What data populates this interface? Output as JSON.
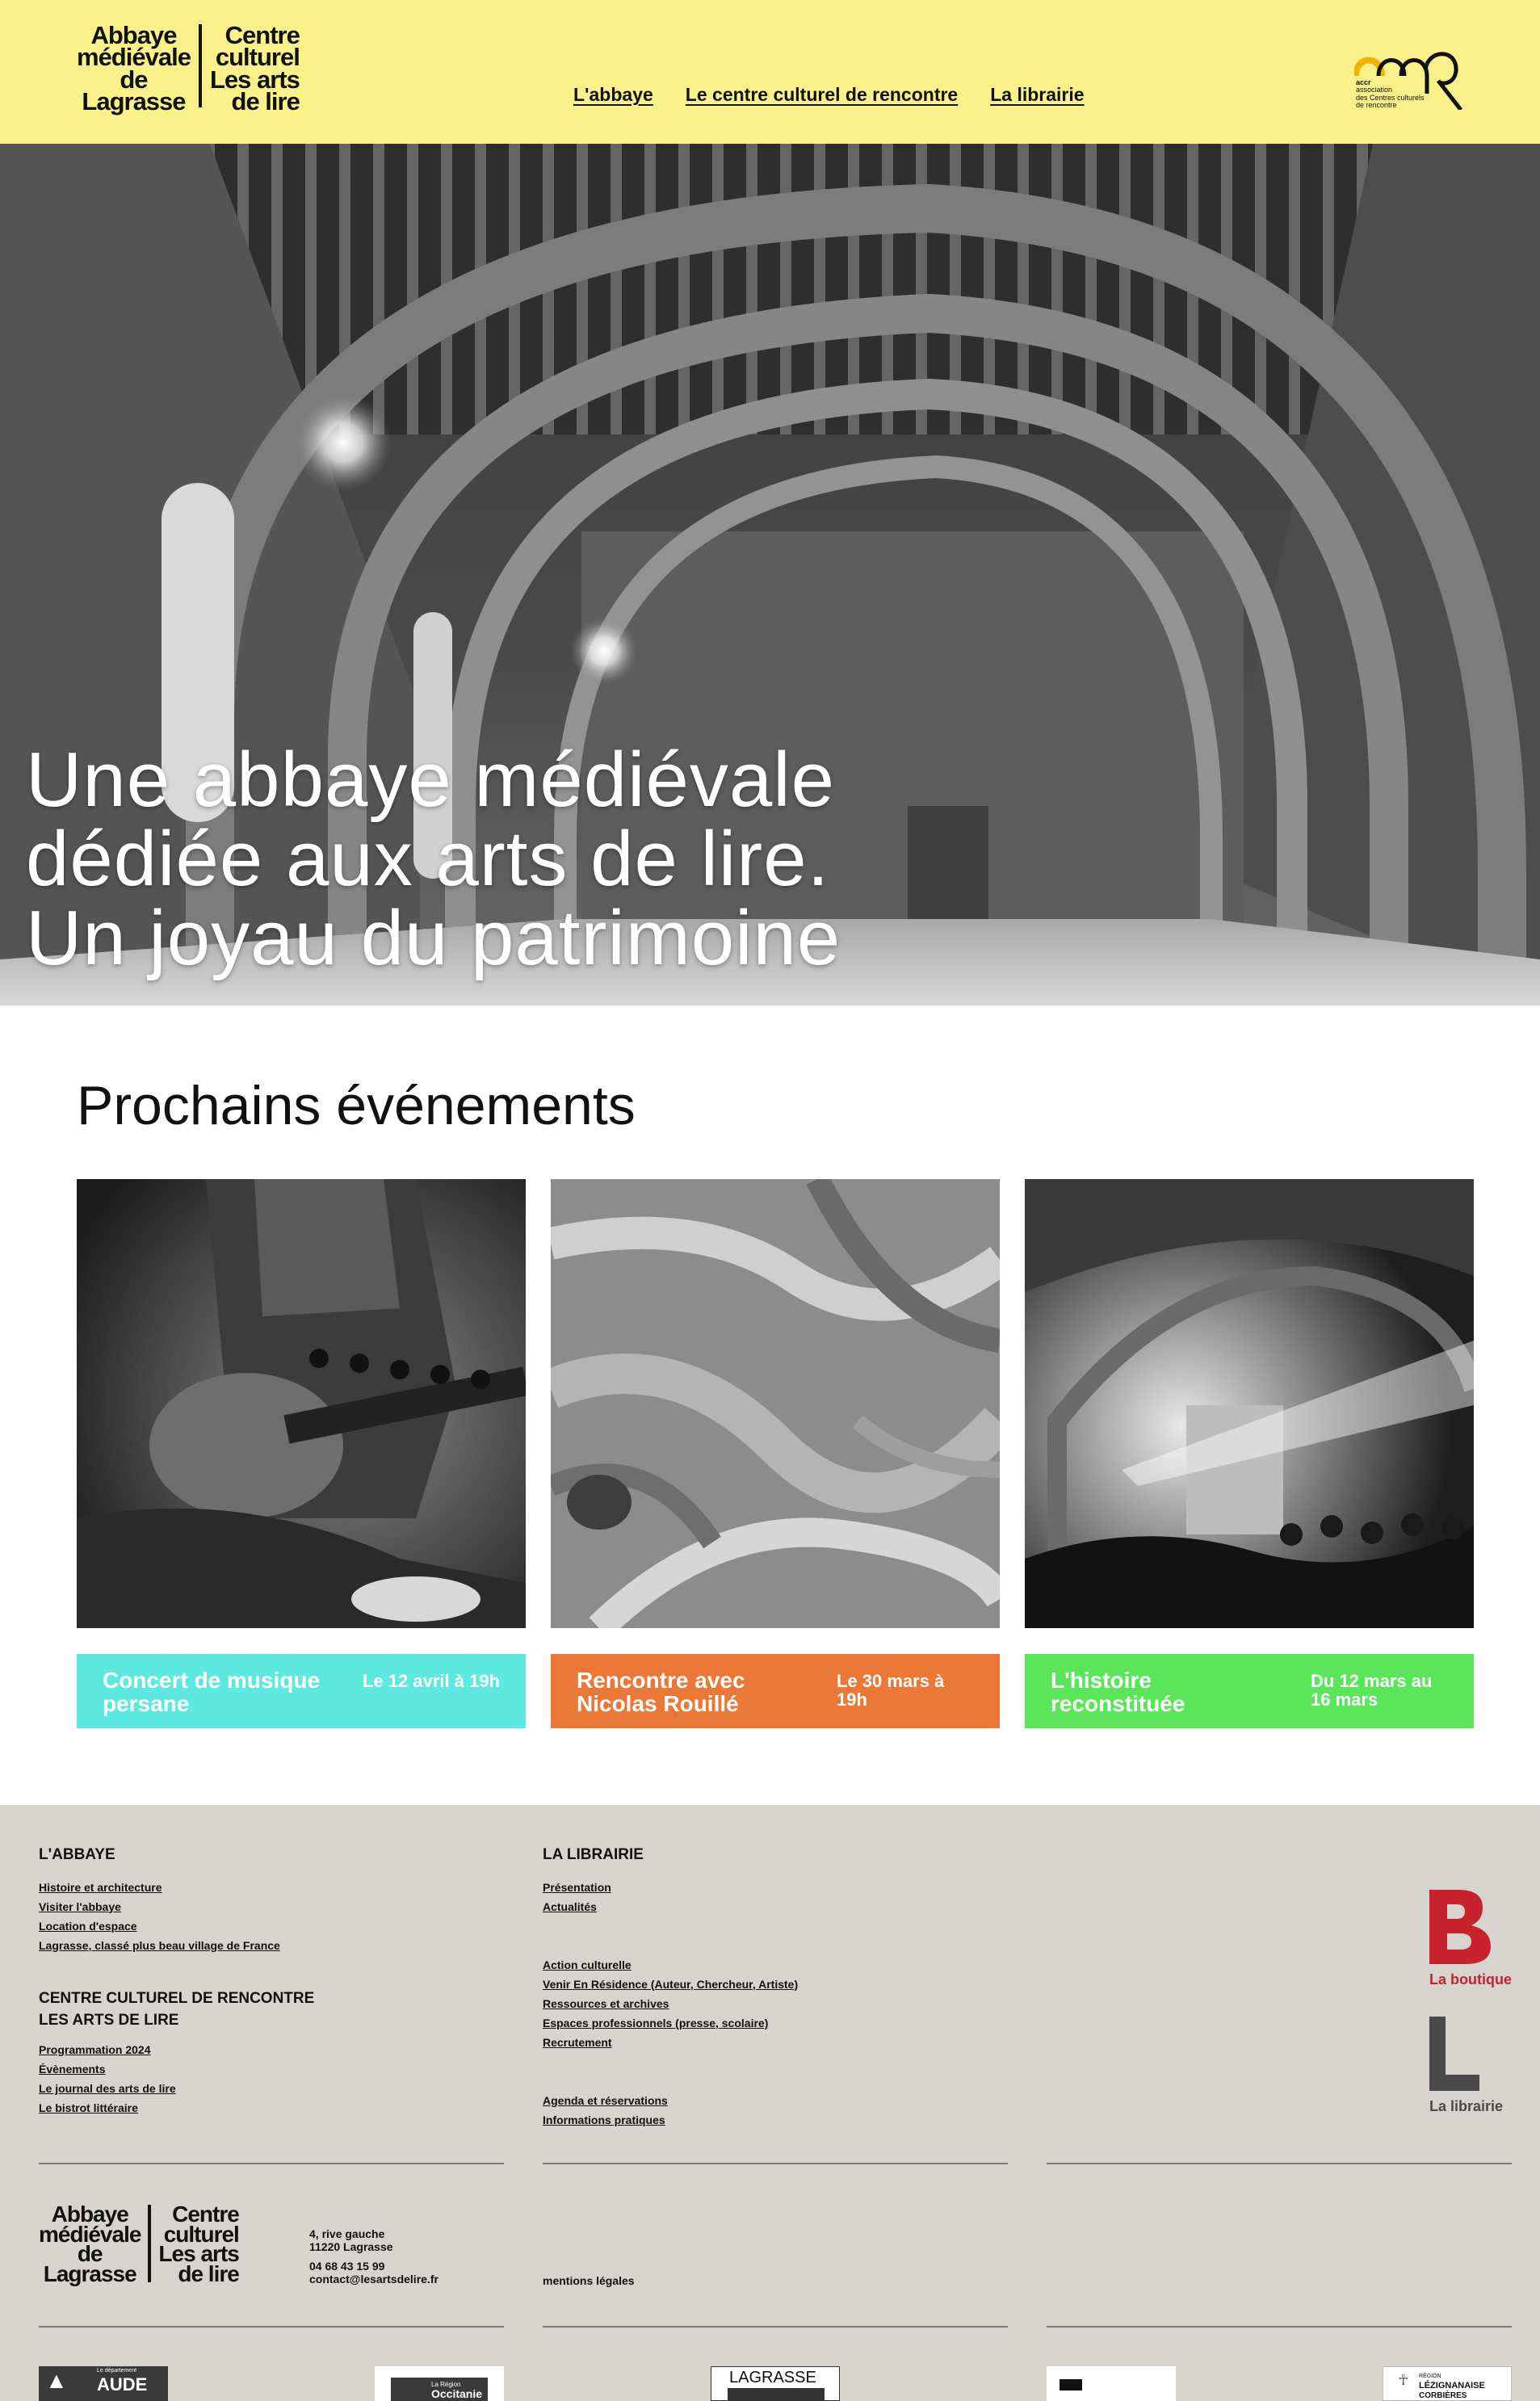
{
  "header": {
    "logo": {
      "left_lines": [
        "Abbaye",
        "médiévale",
        "de",
        "Lagrasse"
      ],
      "right_lines": [
        "Centre",
        "culturel",
        "Les arts",
        "de lire"
      ]
    },
    "nav": [
      "L'abbaye",
      "Le centre culturel de rencontre",
      "La librairie"
    ],
    "accr": {
      "lines": [
        "accr",
        "association",
        "des Centres culturels",
        "de rencontre"
      ]
    }
  },
  "hero": {
    "lines": [
      "Une abbaye médiévale",
      "dédiée aux arts de lire.",
      "Un joyau du patrimoine"
    ]
  },
  "events": {
    "title": "Prochains événements",
    "items": [
      {
        "title": "Concert de musique persane",
        "date": "Le 12 avril à 19h",
        "color": "#5de8e0"
      },
      {
        "title": "Rencontre avec Nicolas Rouillé",
        "date": "Le 30 mars à 19h",
        "color": "#ec7838"
      },
      {
        "title": "L'histoire reconstituée",
        "date": "Du 12 mars au 16 mars",
        "color": "#5be55b"
      }
    ]
  },
  "footer": {
    "abbaye": {
      "heading": "L'ABBAYE",
      "links": [
        "Histoire et architecture",
        "Visiter l'abbaye",
        "Location d'espace",
        "Lagrasse, classé plus beau village de France"
      ]
    },
    "centre": {
      "heading_lines": [
        "CENTRE CULTUREL DE RENCONTRE",
        "LES ARTS DE LIRE"
      ],
      "links": [
        "Programmation 2024",
        "Évènements",
        "Le journal des arts de lire",
        "Le bistrot littéraire"
      ]
    },
    "librairie": {
      "heading": "LA LIBRAIRIE",
      "links_1": [
        "Présentation",
        "Actualités"
      ],
      "links_2": [
        "Action culturelle",
        "Venir En Résidence (Auteur, Chercheur, Artiste)",
        "Ressources et archives",
        "Espaces professionnels (presse, scolaire)",
        "Recrutement"
      ],
      "links_3": [
        "Agenda et réservations",
        "Informations pratiques"
      ]
    },
    "boutique_label": "La boutique",
    "librairie_label": "La librairie",
    "address": [
      "4, rive gauche",
      "11220 Lagrasse"
    ],
    "phone": "04 68 43 15 99",
    "email": "contact@lesartsdelire.fr",
    "mentions": "mentions légales",
    "partners": {
      "aude": "AUDE",
      "aude_sub": "Le département",
      "region_small": "La Région",
      "region": "Occitanie",
      "lagrasse": "LAGRASSE",
      "lezignan_small": "RÉGION",
      "lezignan": "LÉZIGNANAISE",
      "lezignan_2": "CORBIÈRES"
    }
  },
  "colors": {
    "header_bg": "#fbf18a",
    "footer_bg": "#d7d3cf",
    "boutique_red": "#c8232c",
    "librairie_grey": "#4a4a4a"
  }
}
